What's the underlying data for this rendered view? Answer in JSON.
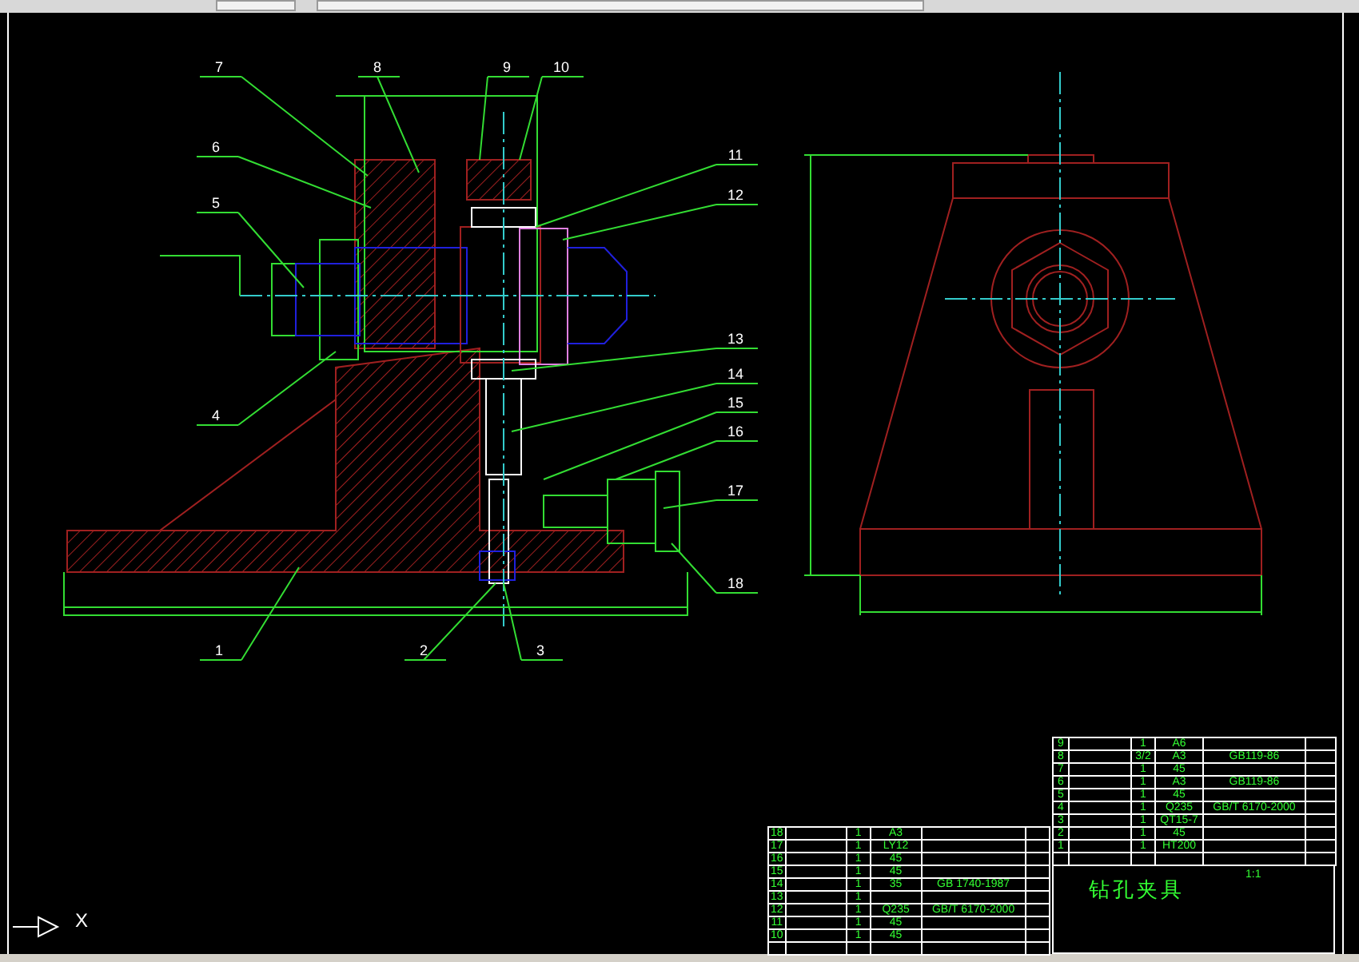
{
  "balloons": [
    "7",
    "8",
    "9",
    "10",
    "6",
    "11",
    "12",
    "5",
    "13",
    "14",
    "15",
    "4",
    "16",
    "17",
    "18",
    "1",
    "2",
    "3"
  ],
  "parts_list_right": [
    {
      "no": "9",
      "qty": "1",
      "material": "A6"
    },
    {
      "no": "8",
      "qty": "3/2",
      "material": "A3",
      "standard": "GB119-86"
    },
    {
      "no": "7",
      "qty": "1",
      "material": "45"
    },
    {
      "no": "6",
      "qty": "1",
      "material": "A3",
      "standard": "GB119-86"
    },
    {
      "no": "5",
      "qty": "1",
      "material": "45"
    },
    {
      "no": "4",
      "qty": "1",
      "material": "Q235",
      "standard": "GB/T 6170-2000"
    },
    {
      "no": "3",
      "qty": "1",
      "material": "QT15-7"
    },
    {
      "no": "2",
      "qty": "1",
      "material": "45"
    },
    {
      "no": "1",
      "qty": "1",
      "material": "HT200"
    }
  ],
  "parts_list_left": [
    {
      "no": "18",
      "qty": "1",
      "material": "A3"
    },
    {
      "no": "17",
      "qty": "1",
      "material": "LY12"
    },
    {
      "no": "16",
      "qty": "1",
      "material": "45"
    },
    {
      "no": "15",
      "qty": "1",
      "material": "45"
    },
    {
      "no": "14",
      "qty": "1",
      "material": "35",
      "standard": "GB 1740-1987"
    },
    {
      "no": "13",
      "qty": "1"
    },
    {
      "no": "12",
      "qty": "1",
      "material": "Q235",
      "standard": "GB/T 6170-2000"
    },
    {
      "no": "11",
      "qty": "1",
      "material": "45"
    },
    {
      "no": "10",
      "qty": "1",
      "material": "45"
    }
  ],
  "title_block": {
    "title": "钻孔夹具",
    "scale": "1:1"
  },
  "ucs_axis_label": "X"
}
